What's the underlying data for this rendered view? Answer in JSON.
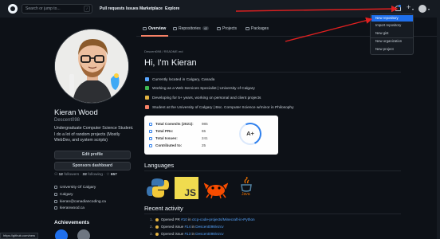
{
  "header": {
    "search_placeholder": "Search or jump to...",
    "search_shortcut": "/",
    "nav": [
      "Pull requests",
      "Issues",
      "Marketplace",
      "Explore"
    ],
    "plus_label": "+",
    "caret": "▾"
  },
  "tabs": {
    "overview": "Overview",
    "repositories": "Repositories",
    "repositories_count": "42",
    "projects": "Projects",
    "packages": "Packages"
  },
  "profile": {
    "name": "Kieran Wood",
    "username": "Descent098",
    "bio": "Undergraduate Computer Science Student. I do a lot of random projects (Mostly WebDev, and system scripts)",
    "edit_button": "Edit profile",
    "sponsors_button": "Sponsors dashboard",
    "followers_count": "12",
    "followers_label": "followers",
    "following_count": "32",
    "following_label": "following",
    "stars_count": "657",
    "meta": [
      "University Of Calgary",
      "Calgary",
      "kieran@canadiancoding.ca",
      "kieranwood.ca"
    ],
    "achievements_title": "Achievements"
  },
  "readme": {
    "path": "Descent098 / README.md",
    "title": "Hi, I'm Kieran",
    "bullets": [
      "Currently located in Calgary, Canada",
      "Working as a Web Services Specialist | University of Calgary",
      "Developing for 5+ years, working on personal and client projects",
      "Student at the University of Calgary | Bsc. Computer Science w/minor in Philosophy"
    ],
    "bullet_colors": [
      "#58a6ff",
      "#3fb950",
      "#e3b341",
      "#f78166"
    ]
  },
  "stats": {
    "rows": [
      {
        "label": "Total Commits (2021):",
        "value": "985"
      },
      {
        "label": "Total PRs:",
        "value": "65"
      },
      {
        "label": "Total Issues:",
        "value": "241"
      },
      {
        "label": "Contributed to:",
        "value": "25"
      }
    ],
    "grade": "A+"
  },
  "languages": {
    "title": "Languages",
    "icons": [
      "python-logo",
      "javascript-logo",
      "rust-logo",
      "java-logo"
    ],
    "js_text": "JS",
    "java_text": "Java"
  },
  "activity": {
    "title": "Recent activity",
    "items": [
      {
        "num": "1.",
        "text": "Opened PR",
        "ref": "#10",
        "mid": "in",
        "repo": "ctcp-code-projects/Minecraft-in-Python"
      },
      {
        "num": "2.",
        "text": "Opened issue",
        "ref": "#14",
        "mid": "in",
        "repo": "Descent098/ezcv"
      },
      {
        "num": "3.",
        "text": "Opened issue",
        "ref": "#13",
        "mid": "in",
        "repo": "Descent098/ezcv"
      }
    ]
  },
  "dropdown": {
    "items": [
      "New repository",
      "Import repository",
      "New gist",
      "New organization",
      "New project"
    ]
  },
  "status_url": "https://github.com/new",
  "colors": {
    "bg": "#0d1117",
    "header": "#161b22",
    "accent": "#1f6feb",
    "annotation_arrow": "#e02020"
  }
}
